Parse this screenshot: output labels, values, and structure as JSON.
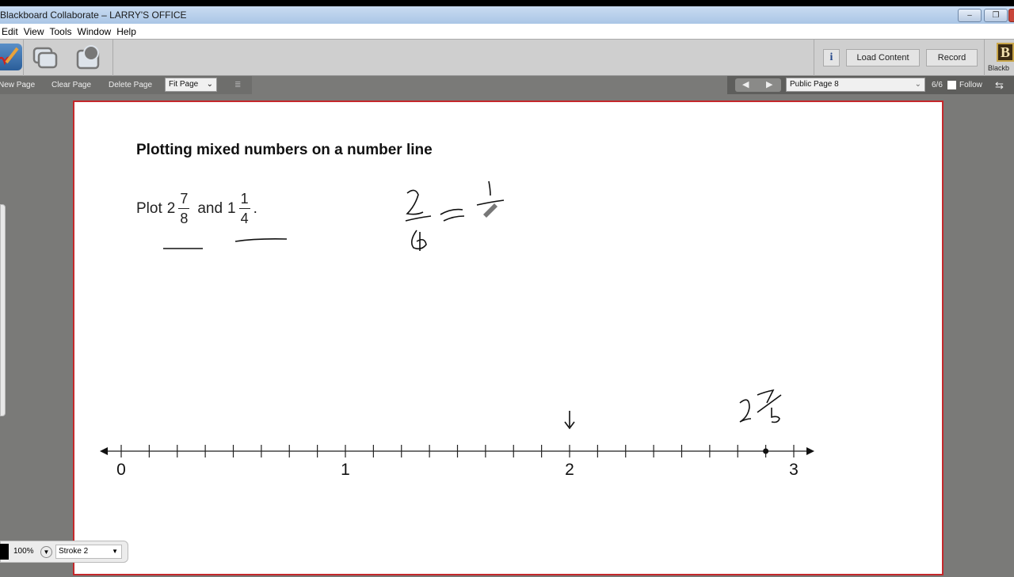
{
  "window": {
    "title": "Blackboard Collaborate – LARRY'S OFFICE"
  },
  "menu": [
    "Edit",
    "View",
    "Tools",
    "Window",
    "Help"
  ],
  "toolbar": {
    "load_content": "Load Content",
    "record": "Record",
    "info": "i",
    "logo": "B",
    "logo_caption": "Blackb"
  },
  "whiteboard_toolbar": {
    "new_page": "New Page",
    "clear_page": "Clear Page",
    "delete_page": "Delete Page",
    "zoom_select": "Fit Page"
  },
  "navigation": {
    "page_select": "Public Page 8",
    "page_count": "6/6",
    "follow_label": "Follow",
    "follow_checked": false
  },
  "content": {
    "heading": "Plotting mixed numbers on a number line",
    "prompt_prefix": "Plot",
    "mixed1": {
      "whole": "2",
      "num": "7",
      "den": "8"
    },
    "conjunction": "and",
    "mixed2": {
      "whole": "1",
      "num": "1",
      "den": "4"
    },
    "period": ".",
    "number_line": {
      "labels": [
        "0",
        "1",
        "2",
        "3"
      ],
      "min": 0,
      "max": 3,
      "ticks_per_unit": 8,
      "plotted_point": 2.875
    }
  },
  "bottom_tools": {
    "zoom": "100%",
    "stroke": "Stroke 2",
    "color": "#000000"
  },
  "colors": {
    "board_border": "#c4282b",
    "title_bar": "#b8d0ec"
  }
}
